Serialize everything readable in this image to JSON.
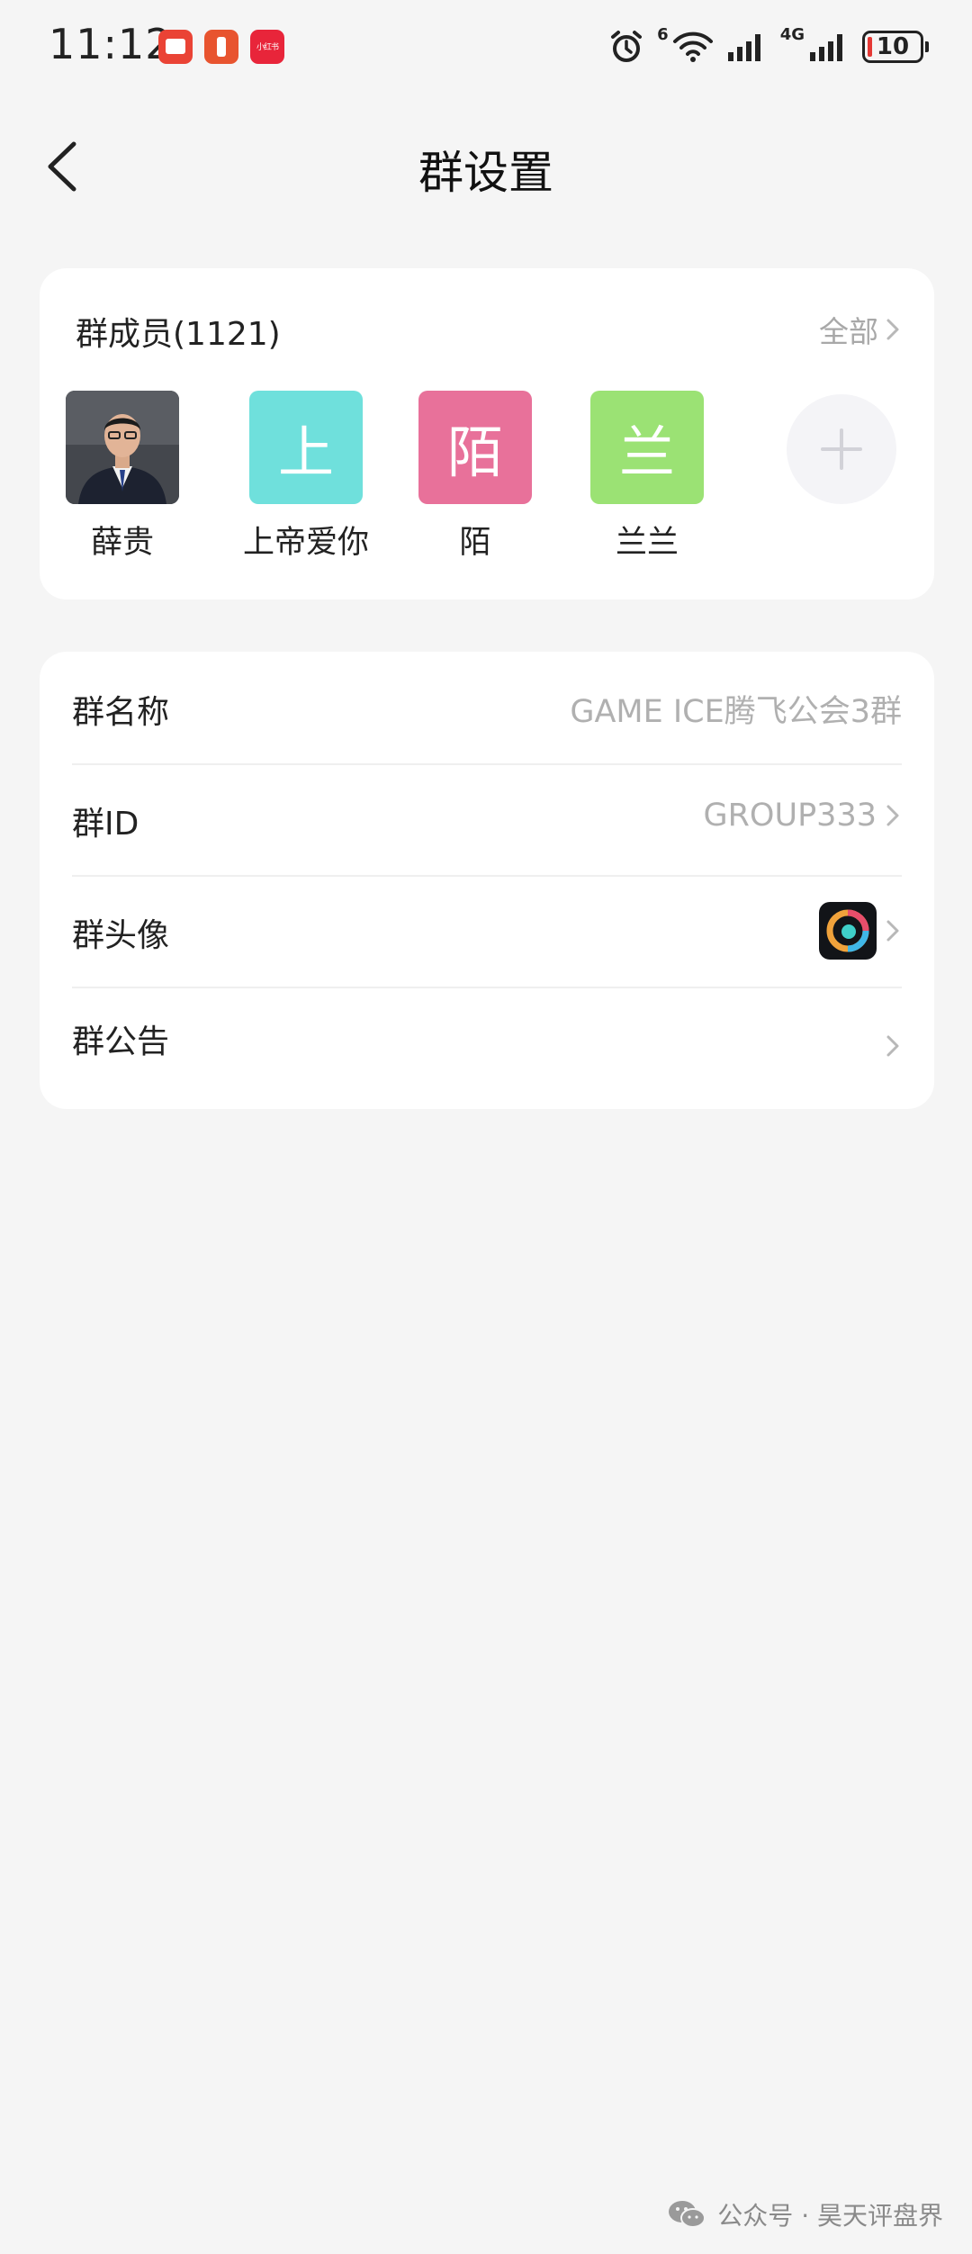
{
  "status_bar": {
    "time": "11:12",
    "notification_small_text": "小红书",
    "network_label_1": "6",
    "network_label_2": "4G",
    "battery_level": "10"
  },
  "header": {
    "title": "群设置"
  },
  "members": {
    "title": "群成员(1121)",
    "view_all_label": "全部",
    "list": [
      {
        "name": "薛贵",
        "avatar_type": "photo"
      },
      {
        "name": "上帝爱你",
        "avatar_char": "上",
        "color": "#6fe0dc"
      },
      {
        "name": "陌",
        "avatar_char": "陌",
        "color": "#e8719a"
      },
      {
        "name": "兰兰",
        "avatar_char": "兰",
        "color": "#9be274"
      }
    ],
    "add_icon": "plus-icon"
  },
  "settings": {
    "group_name_label": "群名称",
    "group_name_value": "GAME ICE腾飞公会3群",
    "group_id_label": "群ID",
    "group_id_value": "GROUP333",
    "group_avatar_label": "群头像",
    "group_notice_label": "群公告"
  },
  "watermark": {
    "text": "公众号 · 昊天评盘界"
  },
  "colors": {
    "background": "#f5f5f5",
    "card": "#ffffff",
    "muted_text": "#b0b0b0"
  }
}
